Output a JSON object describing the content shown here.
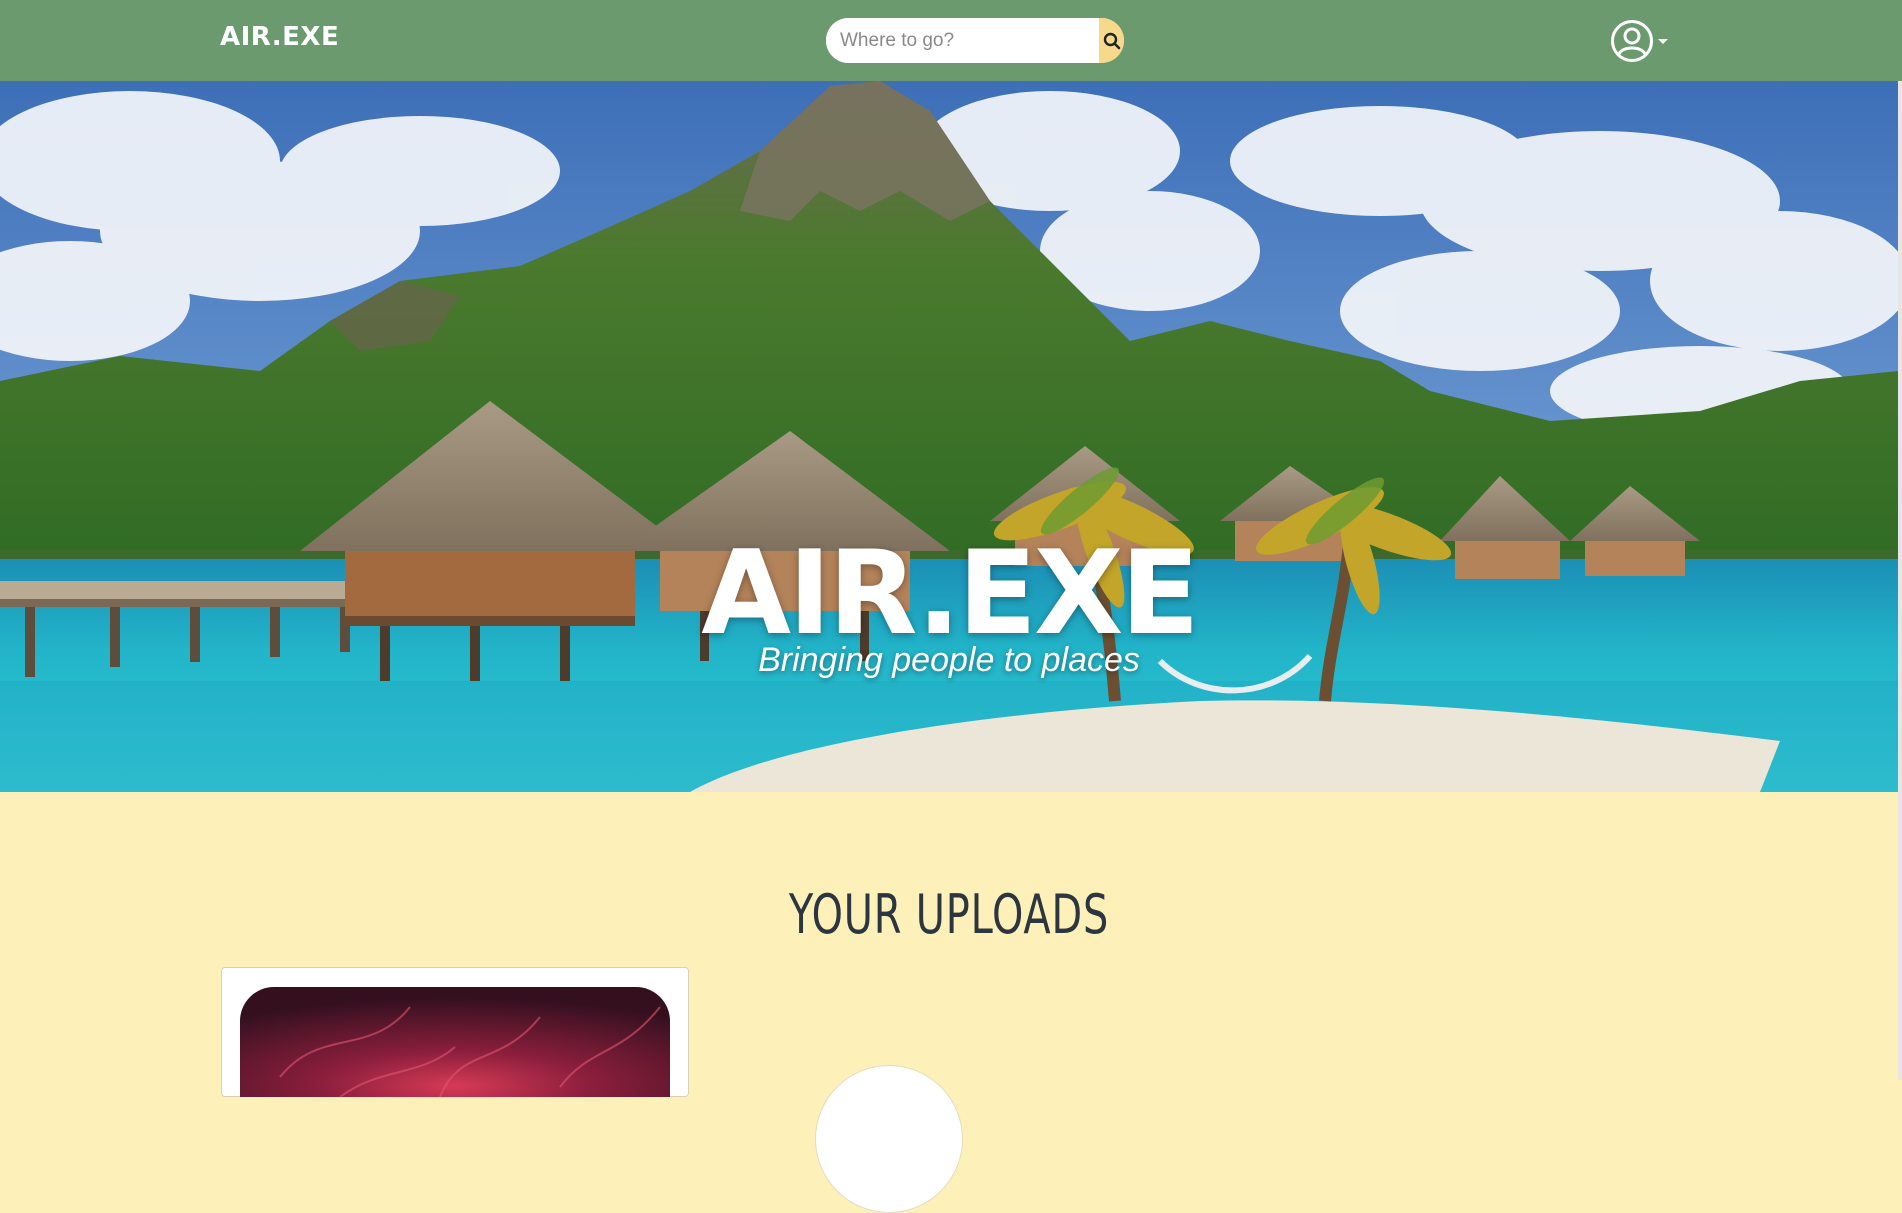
{
  "navbar": {
    "brand": "AIR.EXE",
    "search": {
      "placeholder": "Where to go?",
      "value": ""
    },
    "icons": {
      "search": "search-icon",
      "user": "user-circle-icon",
      "caret": "caret-down-icon"
    }
  },
  "hero": {
    "title": "AIR.EXE",
    "subtitle": "Bringing people to places"
  },
  "uploads": {
    "title": "YOUR UPLOADS"
  },
  "colors": {
    "navbar": "#6a9a6e",
    "page_background": "#fdf0b9",
    "search_button": "#f6d98a",
    "heading_text": "#2c3640"
  }
}
